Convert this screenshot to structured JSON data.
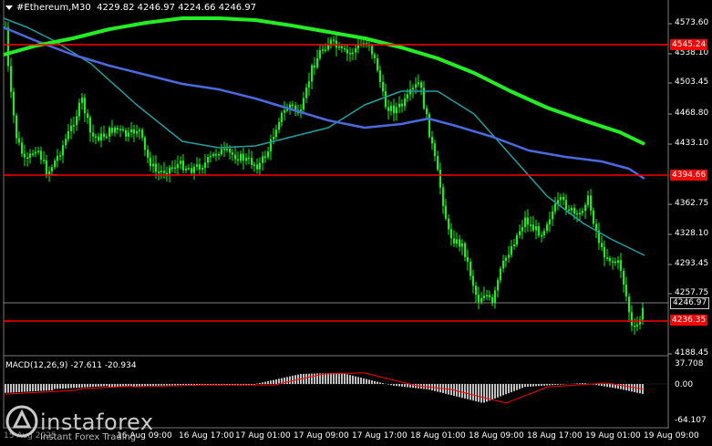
{
  "header": {
    "symbol": "#Ethereum,M30",
    "ohlc": "4229.82 4246.97 4224.66 4246.97"
  },
  "colors": {
    "background": "#000000",
    "candle": "#00ff00",
    "ma_fast": "#1fa0a0",
    "ma_mid": "#4a6be0",
    "ma_slow": "#22ee22",
    "level_line": "#ff0000",
    "macd_hist": "#c0c0c0",
    "macd_signal": "#ff0000"
  },
  "price_axis": {
    "labels": [
      "4573.60",
      "4538.10",
      "4503.45",
      "4468.80",
      "4433.10",
      "4362.75",
      "4328.10",
      "4293.45",
      "4257.75",
      "4188.45"
    ]
  },
  "levels": [
    {
      "value": "4545.24"
    },
    {
      "value": "4394.66"
    },
    {
      "value": "4236.35"
    }
  ],
  "current_price": "4246.97",
  "macd": {
    "label": "MACD(12,26,9) -27.611 -20.934",
    "axis_labels": [
      "37.708",
      "0.00",
      "-64.107"
    ]
  },
  "time_axis": {
    "labels": [
      "15 Aug 2025",
      "16 Aug 09:00",
      "16 Aug 17:00",
      "17 Aug 01:00",
      "17 Aug 09:00",
      "17 Aug 17:00",
      "18 Aug 01:00",
      "18 Aug 09:00",
      "18 Aug 17:00",
      "19 Aug 01:00",
      "19 Aug 09:00"
    ]
  },
  "watermark": {
    "brand": "instaforex",
    "tagline": "Instant Forex Trading"
  }
}
